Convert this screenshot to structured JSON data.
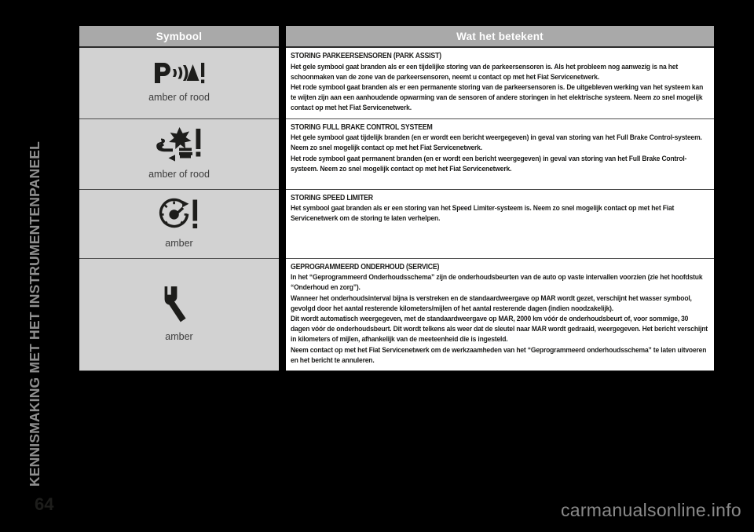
{
  "chapter": {
    "title": "KENNISMAKING MET HET INSTRUMENTENPANEEL"
  },
  "table": {
    "headers": {
      "symbol": "Symbool",
      "meaning": "Wat het betekent"
    },
    "rows": [
      {
        "icon_name": "park-assist-icon",
        "icon_label": "P-sonar-exclamation",
        "color_label": "amber of rood",
        "title": "STORING PARKEERSENSOREN (PARK ASSIST)",
        "paragraphs": [
          "Het gele symbool gaat branden als er een tijdelijke storing van de parkeersensoren is. Als het probleem nog aanwezig is na het schoonmaken van de zone van de parkeersensoren, neemt u contact op met het Fiat Servicenetwerk.",
          "Het rode symbool gaat branden als er een permanente storing van de parkeersensoren is. De uitgebleven werking van het systeem kan te wijten zijn aan een aanhoudende opwarming van de sensoren of andere storingen in het elektrische systeem. Neem zo snel mogelijk contact op met het Fiat Servicenetwerk."
        ]
      },
      {
        "icon_name": "full-brake-control-icon",
        "icon_label": "collision-star-arrow-exclamation",
        "color_label": "amber of rood",
        "title": "STORING FULL BRAKE CONTROL SYSTEEM",
        "paragraphs": [
          "Het gele symbool gaat tijdelijk branden (en er wordt een bericht weergegeven) in geval van storing van het Full Brake Control-systeem. Neem zo snel mogelijk contact op met het Fiat Servicenetwerk.",
          "Het rode symbool gaat permanent branden (en er wordt een bericht weergegeven) in geval van storing van het Full Brake Control-systeem. Neem zo snel mogelijk contact op met het Fiat Servicenetwerk."
        ]
      },
      {
        "icon_name": "speed-limiter-icon",
        "icon_label": "speedometer-exclamation",
        "color_label": "amber",
        "title": "STORING SPEED LIMITER",
        "paragraphs": [
          "Het symbool gaat branden als er een storing van het Speed Limiter-systeem is. Neem zo snel mogelijk contact op met het Fiat Servicenetwerk om de storing te laten verhelpen."
        ]
      },
      {
        "icon_name": "scheduled-service-icon",
        "icon_label": "wrench",
        "color_label": "amber",
        "title": "GEPROGRAMMEERD ONDERHOUD (SERVICE)",
        "paragraphs": [
          "In het “Geprogrammeerd Onderhoudsschema” zijn de onderhoudsbeurten van de auto op vaste intervallen voorzien (zie het hoofdstuk “Onderhoud en zorg”).",
          "Wanneer het onderhoudsinterval bijna is verstreken en de standaardweergave op MAR wordt gezet, verschijnt het wasser symbool, gevolgd door het aantal resterende kilometers/mijlen of het aantal resterende dagen (indien noodzakelijk).",
          "Dit wordt automatisch weergegeven, met de standaardweergave op MAR, 2000 km vóór de onderhoudsbeurt of, voor sommige, 30 dagen vóór de onderhoudsbeurt. Dit wordt telkens als weer dat de sleutel naar MAR wordt gedraaid, weergegeven. Het bericht verschijnt in kilometers of mijlen, afhankelijk van de meeteenheid die is ingesteld.",
          "Neem contact op met het Fiat Servicenetwerk om de werkzaamheden van het “Geprogrammeerd onderhoudsschema” te laten uitvoeren en het bericht te annuleren."
        ]
      }
    ]
  },
  "footer": {
    "page_number": "64",
    "watermark": "carmanualsonline.info"
  }
}
